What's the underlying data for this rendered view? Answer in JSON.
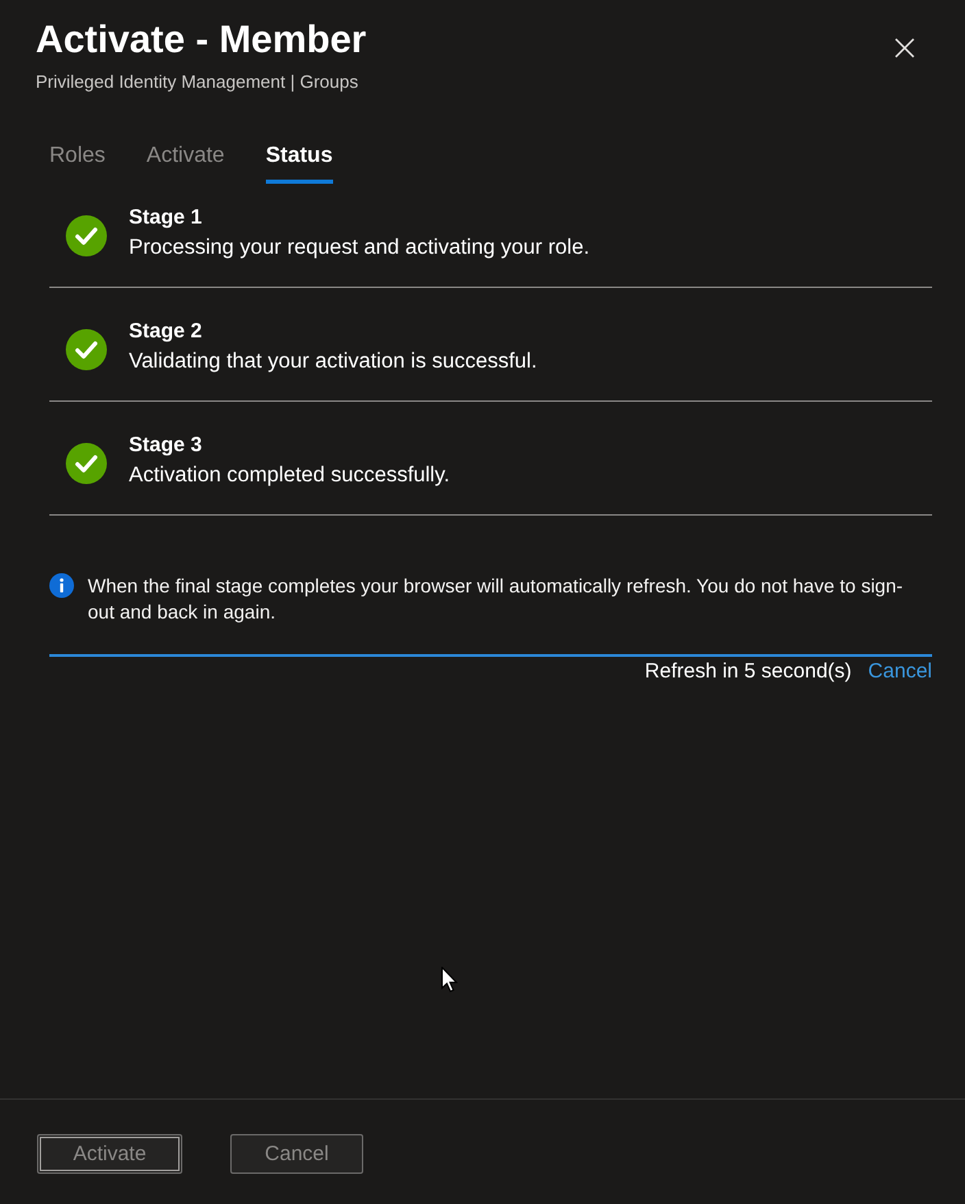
{
  "panel": {
    "title": "Activate - Member",
    "subtitle": "Privileged Identity Management | Groups"
  },
  "tabs": [
    {
      "label": "Roles",
      "selected": false
    },
    {
      "label": "Activate",
      "selected": false
    },
    {
      "label": "Status",
      "selected": true
    }
  ],
  "stages": [
    {
      "title": "Stage 1",
      "description": "Processing your request and activating your role.",
      "completed": true
    },
    {
      "title": "Stage 2",
      "description": "Validating that your activation is successful.",
      "completed": true
    },
    {
      "title": "Stage 3",
      "description": "Activation completed successfully.",
      "completed": true
    }
  ],
  "info": {
    "text": "When the final stage completes your browser will automatically refresh. You do not have to sign-out and back in again."
  },
  "progress": {
    "level": 1
  },
  "refresh": {
    "message": "Refresh in 5 second(s)",
    "cancel_link": "Cancel"
  },
  "footer_buttons": [
    {
      "label": "Activate",
      "disabled": true,
      "focused": true
    },
    {
      "label": "Cancel",
      "disabled": true,
      "focused": false
    }
  ]
}
